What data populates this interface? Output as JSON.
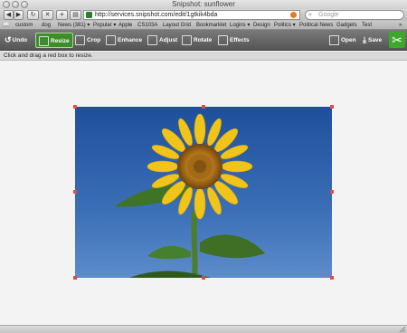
{
  "window": {
    "title": "Snipshot: sunflower"
  },
  "nav": {
    "back": "◀",
    "forward": "▶",
    "reload": "↻",
    "stop": "✕",
    "add": "+",
    "url": "http://services.snipshot.com/edit/1gtkik4bda",
    "search_placeholder": "Google"
  },
  "bookmarks": [
    "custom",
    "dog",
    "News (381) ▾",
    "Popular ▾",
    "Apple",
    "CS103A",
    "Layout Grid",
    "Bookmarklet",
    "Logins ▾",
    "Design",
    "Politics ▾",
    "Political News",
    "Gadgets",
    "Test",
    "»"
  ],
  "toolbar": {
    "undo": "Undo",
    "resize": "Resize",
    "crop": "Crop",
    "enhance": "Enhance",
    "adjust": "Adjust",
    "rotate": "Rotate",
    "effects": "Effects",
    "open": "Open",
    "save": "Save"
  },
  "hint": "Click and drag a red box to resize.",
  "colors": {
    "accent_active": "#3f8d2a",
    "handle": "#e24a4a",
    "sky": "#2e5fa8"
  },
  "icons": {
    "logo": "snipshot-logo-icon"
  }
}
